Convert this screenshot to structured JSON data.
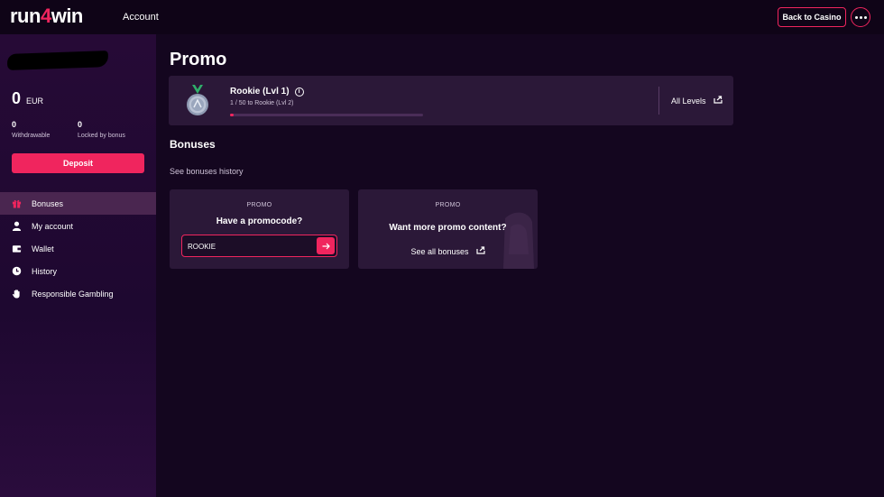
{
  "header": {
    "logo_pre": "run",
    "logo_four": "4",
    "logo_post": "win",
    "section": "Account",
    "back_label": "Back to Casino",
    "more_icon": "ellipsis-icon"
  },
  "sidebar": {
    "balance_amount": "0",
    "balance_currency": "EUR",
    "withdrawable_value": "0",
    "withdrawable_label": "Withdrawable",
    "locked_value": "0",
    "locked_label": "Locked by bonus",
    "deposit_label": "Deposit",
    "items": [
      {
        "label": "Bonuses",
        "icon": "gift-icon",
        "active": true
      },
      {
        "label": "My account",
        "icon": "user-icon",
        "active": false
      },
      {
        "label": "Wallet",
        "icon": "wallet-icon",
        "active": false
      },
      {
        "label": "History",
        "icon": "clock-icon",
        "active": false
      },
      {
        "label": "Responsible Gambling",
        "icon": "hand-icon",
        "active": false
      }
    ]
  },
  "main": {
    "title": "Promo",
    "level": {
      "name": "Rookie (Lvl 1)",
      "progress_text": "1 / 50 to Rookie (Lvl 2)",
      "progress_fraction": 0.02,
      "all_levels_label": "All Levels"
    },
    "bonuses_title": "Bonuses",
    "history_link": "See bonuses history",
    "promo_code_card": {
      "tag": "PROMO",
      "question": "Have a promocode?",
      "input_value": "ROOKIE"
    },
    "promo_content_card": {
      "tag": "PROMO",
      "question": "Want more promo content?",
      "link": "See all bonuses"
    }
  },
  "colors": {
    "accent": "#f0255e",
    "background": "#14061f",
    "card": "#2b1838"
  }
}
